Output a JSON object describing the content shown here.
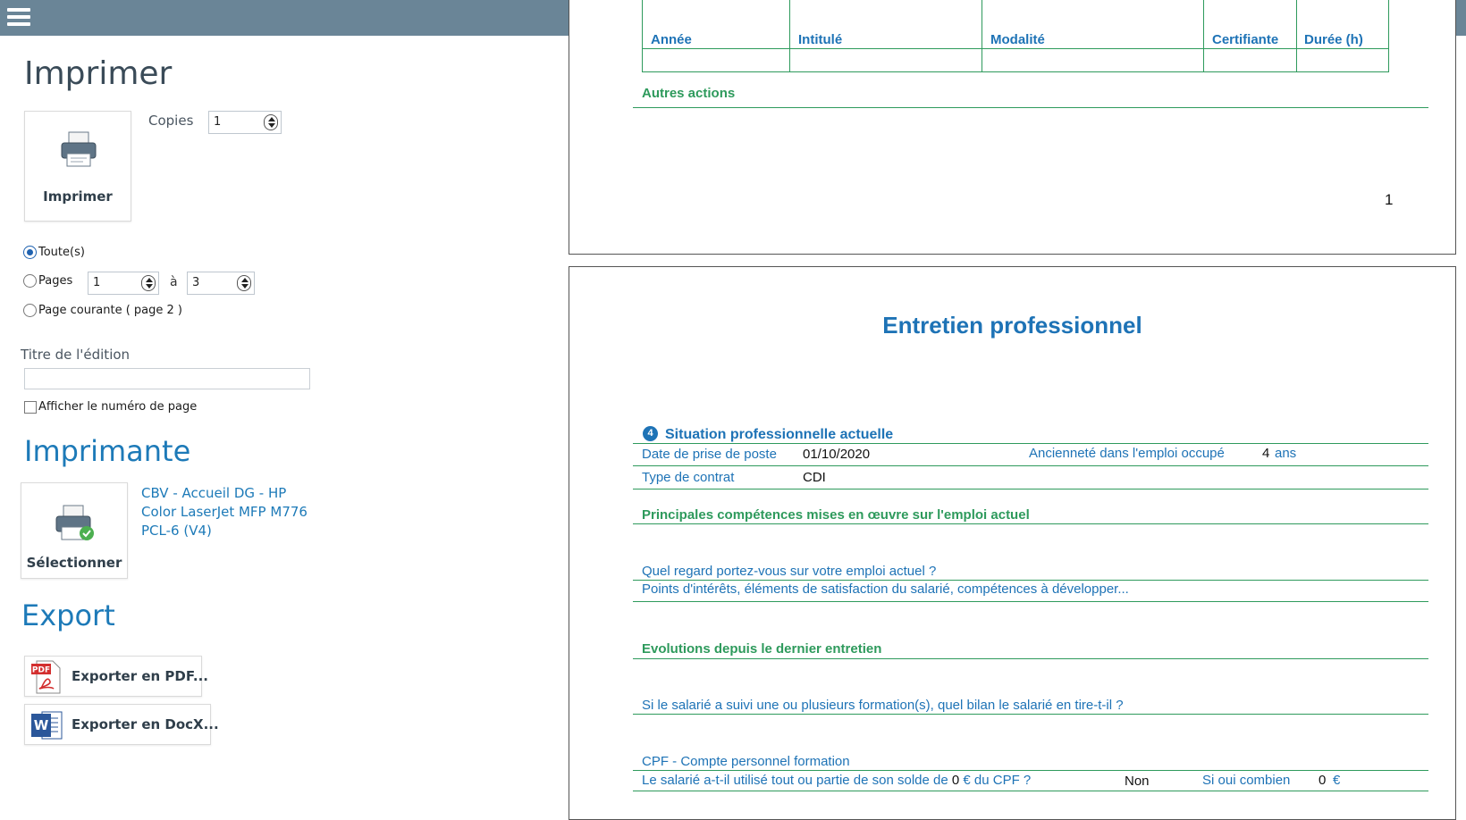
{
  "left_panel": {
    "print_heading": "Imprimer",
    "print_button_label": "Imprimer",
    "copies_label": "Copies",
    "copies_value": "1",
    "range_all_label": "Toute(s)",
    "range_pages_label": "Pages",
    "range_from_value": "1",
    "range_to_label": "à",
    "range_to_value": "3",
    "range_current_label": "Page courante ( page 2 )",
    "selected_range": "all",
    "edition_title_label": "Titre de l'édition",
    "edition_title_value": "",
    "show_page_number_label": "Afficher le numéro de page",
    "show_page_number_checked": false,
    "printer_heading": "Imprimante",
    "select_button_label": "Sélectionner",
    "printer_name": "CBV - Accueil DG - HP Color LaserJet MFP M776 PCL-6 (V4)",
    "export_heading": "Export",
    "export_pdf_label": "Exporter en PDF...",
    "export_docx_label": "Exporter en DocX..."
  },
  "preview": {
    "page1": {
      "table_headers": [
        "Année",
        "Intitulé",
        "Modalité",
        "Certifiante",
        "Durée (h)"
      ],
      "other_actions_heading": "Autres actions",
      "page_number": "1"
    },
    "page2": {
      "title": "Entretien professionnel",
      "section_number": "4",
      "section_title": "Situation professionnelle actuelle",
      "start_date_label": "Date de prise de poste",
      "start_date_value": "01/10/2020",
      "seniority_label": "Ancienneté dans l'emploi occupé",
      "seniority_value": "4",
      "seniority_unit": "ans",
      "contract_label": "Type de contrat",
      "contract_value": "CDI",
      "skills_heading": "Principales compétences mises en œuvre sur l'emploi actuel",
      "view_question": "Quel regard portez-vous sur votre emploi actuel ?",
      "view_hint": "Points d'intérêts, éléments de satisfaction du salarié, compétences à développer...",
      "evolutions_heading": "Evolutions depuis le dernier entretien",
      "training_question": "Si le salarié a suivi une ou plusieurs formation(s), quel bilan le salarié en tire-t-il ?",
      "cpf_title": "CPF - Compte personnel formation",
      "cpf_question_start": "Le salarié a-t-il utilisé tout ou partie de son solde de",
      "cpf_balance": "0",
      "cpf_question_end": "€ du CPF ?",
      "cpf_answer": "Non",
      "cpf_if_yes_label": "Si oui combien",
      "cpf_amount": "0",
      "cpf_currency": "€"
    }
  },
  "colors": {
    "topbar": "#6a8597",
    "accent_blue": "#1d7ab8",
    "doc_green": "#2e9a5c",
    "doc_blue": "#1e73b6"
  },
  "icons": [
    "menu-icon",
    "printer-icon",
    "printer-check-icon",
    "pdf-icon",
    "word-icon"
  ]
}
